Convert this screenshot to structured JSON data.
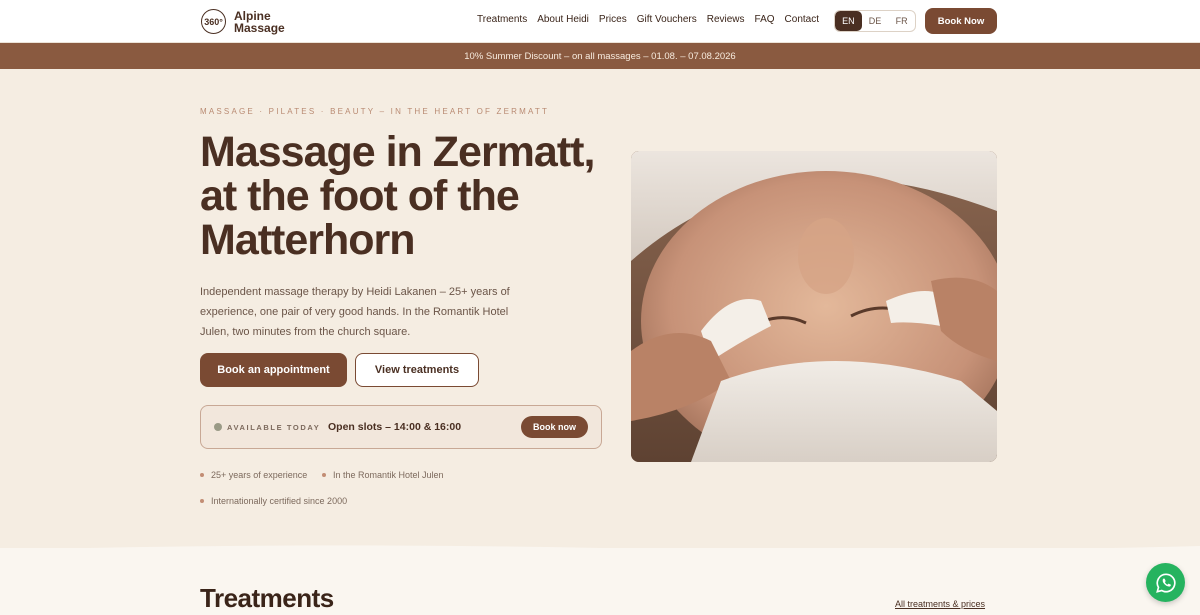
{
  "header": {
    "logo_badge": "360°",
    "logo_line1": "Alpine",
    "logo_line2": "Massage",
    "nav": [
      "Treatments",
      "About Heidi",
      "Prices",
      "Gift Vouchers",
      "Reviews",
      "FAQ",
      "Contact"
    ],
    "languages": [
      "EN",
      "DE",
      "FR"
    ],
    "active_language": "EN",
    "book_label": "Book Now"
  },
  "promo": {
    "text": "10% Summer Discount – on all massages – 01.08. – 07.08.2026"
  },
  "hero": {
    "eyebrow": "MASSAGE · PILATES · BEAUTY – IN THE HEART OF ZERMATT",
    "headline": "Massage in Zermatt, at the foot of the Matterhorn",
    "lead": "Independent massage therapy by Heidi Lakanen – 25+ years of experience, one pair of very good hands. In the Romantik Hotel Julen, two minutes from the church square.",
    "primary_button": "Book an appointment",
    "secondary_button": "View treatments",
    "availability": {
      "label": "AVAILABLE TODAY",
      "slots": "Open slots – 14:00 & 16:00",
      "button": "Book now"
    },
    "bullets": [
      "25+ years of experience",
      "In the Romantik Hotel Julen",
      "Internationally certified since 2000"
    ]
  },
  "treatments": {
    "title": "Treatments",
    "link": "All treatments & prices"
  },
  "colors": {
    "brand": "#7a4a33",
    "dark": "#4a2f22",
    "background": "#f5ede2",
    "whatsapp": "#25b35f"
  },
  "icons": {
    "chat": "whatsapp-icon"
  }
}
